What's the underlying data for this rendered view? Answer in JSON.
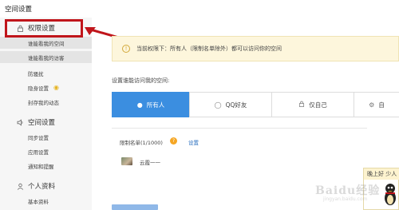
{
  "page_title": "空间设置",
  "sidebar": {
    "sections": [
      {
        "label": "权限设置",
        "icon": "lock-icon",
        "items": [
          {
            "label": "谁能看我的空间",
            "active": true
          },
          {
            "label": "谁能看我的访客",
            "active": true
          },
          {
            "label": "防骚扰"
          },
          {
            "label": "隐身设置"
          },
          {
            "label": "封存我的动态"
          }
        ]
      },
      {
        "label": "空间设置",
        "icon": "speaker-icon",
        "items": [
          {
            "label": "同步设置"
          },
          {
            "label": "应用设置"
          },
          {
            "label": "通知和提醒"
          }
        ]
      },
      {
        "label": "个人资料",
        "icon": "person-icon",
        "items": [
          {
            "label": "基本资料"
          }
        ]
      }
    ]
  },
  "notice": {
    "text": "当前权限下：所有人（限制名单除外）都可以访问你的空间"
  },
  "access": {
    "label": "设置谁能访问我的空间:",
    "options": [
      {
        "label": "所有人",
        "icon": "globe-icon",
        "selected": true
      },
      {
        "label": "QQ好友",
        "icon": "penguin-icon"
      },
      {
        "label": "仅自己",
        "icon": "lock-icon"
      },
      {
        "label": "自",
        "icon": "gear-icon"
      }
    ]
  },
  "limit_list": {
    "label": "限制名单(1/1000)",
    "help": "?",
    "settings_link": "设置",
    "users": [
      {
        "name": "云霞一一"
      }
    ]
  },
  "chat": {
    "greeting": "晚上好 少人"
  },
  "watermark": {
    "brand": "Baidu经验",
    "url": "jingyan.baidu.com"
  },
  "colors": {
    "highlight_box": "#c0151b",
    "accent": "#3b8ee0",
    "notice_bg": "#fdf6dc"
  }
}
